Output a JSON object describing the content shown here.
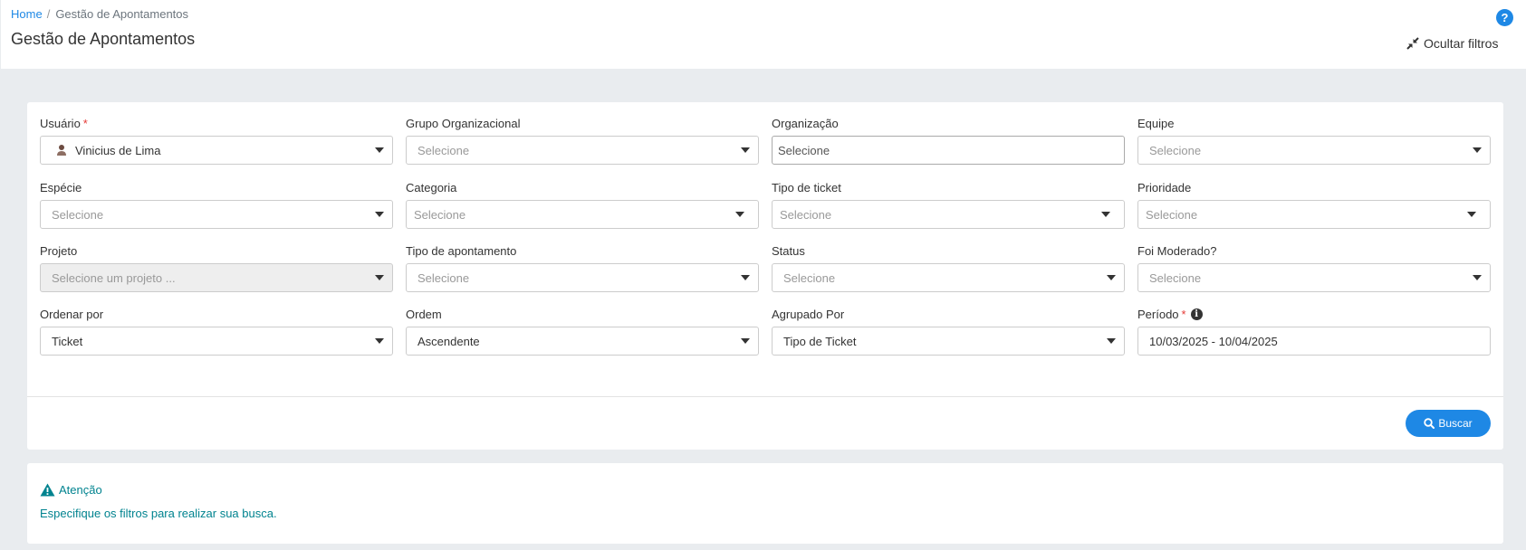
{
  "breadcrumb": {
    "home": "Home",
    "separator": "/",
    "current": "Gestão de Apontamentos"
  },
  "page": {
    "title": "Gestão de Apontamentos",
    "help": "?",
    "hide_filters": "Ocultar filtros"
  },
  "fields": {
    "usuario": {
      "label": "Usuário",
      "required": "*",
      "value": "Vinicius de Lima"
    },
    "grupo_organizacional": {
      "label": "Grupo Organizacional",
      "placeholder": "Selecione"
    },
    "organizacao": {
      "label": "Organização",
      "placeholder": "Selecione"
    },
    "equipe": {
      "label": "Equipe",
      "placeholder": "Selecione"
    },
    "especie": {
      "label": "Espécie",
      "placeholder": "Selecione"
    },
    "categoria": {
      "label": "Categoria",
      "placeholder": "Selecione"
    },
    "tipo_ticket": {
      "label": "Tipo de ticket",
      "placeholder": "Selecione"
    },
    "prioridade": {
      "label": "Prioridade",
      "placeholder": "Selecione"
    },
    "projeto": {
      "label": "Projeto",
      "placeholder": "Selecione um projeto ..."
    },
    "tipo_apontamento": {
      "label": "Tipo de apontamento",
      "placeholder": "Selecione"
    },
    "status": {
      "label": "Status",
      "placeholder": "Selecione"
    },
    "foi_moderado": {
      "label": "Foi Moderado?",
      "placeholder": "Selecione"
    },
    "ordenar_por": {
      "label": "Ordenar por",
      "value": "Ticket"
    },
    "ordem": {
      "label": "Ordem",
      "value": "Ascendente"
    },
    "agrupado_por": {
      "label": "Agrupado Por",
      "value": "Tipo de Ticket"
    },
    "periodo": {
      "label": "Período",
      "required": "*",
      "value": "10/03/2025 - 10/04/2025",
      "info": "i"
    }
  },
  "actions": {
    "search": "Buscar"
  },
  "alert": {
    "title": "Atenção",
    "message": "Especifique os filtros para realizar sua busca."
  },
  "colors": {
    "primary": "#1e88e5",
    "alert_text": "#00838f",
    "required": "#e53935",
    "background": "#e9ecef"
  }
}
